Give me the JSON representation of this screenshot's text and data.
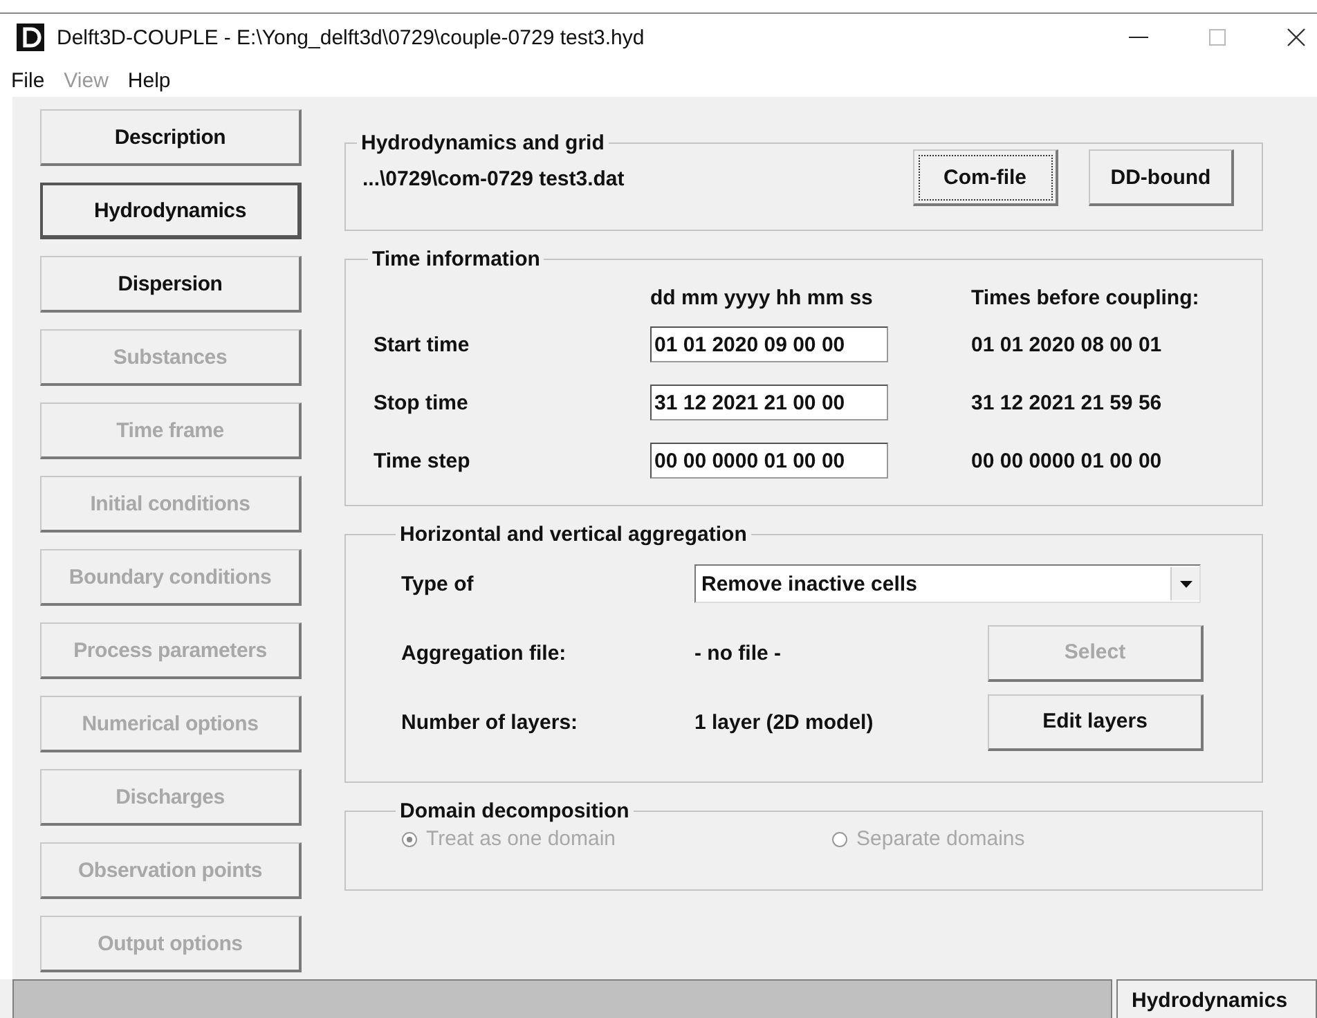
{
  "window": {
    "title": "Delft3D-COUPLE - E:\\Yong_delft3d\\0729\\couple-0729 test3.hyd"
  },
  "menu": [
    {
      "label": "File",
      "disabled": false
    },
    {
      "label": "View",
      "disabled": true
    },
    {
      "label": "Help",
      "disabled": false
    }
  ],
  "nav": [
    {
      "label": "Description",
      "disabled": false,
      "selected": false
    },
    {
      "label": "Hydrodynamics",
      "disabled": false,
      "selected": true
    },
    {
      "label": "Dispersion",
      "disabled": false,
      "selected": false
    },
    {
      "label": "Substances",
      "disabled": true,
      "selected": false
    },
    {
      "label": "Time frame",
      "disabled": true,
      "selected": false
    },
    {
      "label": "Initial conditions",
      "disabled": true,
      "selected": false
    },
    {
      "label": "Boundary conditions",
      "disabled": true,
      "selected": false
    },
    {
      "label": "Process parameters",
      "disabled": true,
      "selected": false
    },
    {
      "label": "Numerical options",
      "disabled": true,
      "selected": false
    },
    {
      "label": "Discharges",
      "disabled": true,
      "selected": false
    },
    {
      "label": "Observation points",
      "disabled": true,
      "selected": false
    },
    {
      "label": "Output options",
      "disabled": true,
      "selected": false
    }
  ],
  "hydro": {
    "title": "Hydrodynamics and grid",
    "file": "...\\0729\\com-0729 test3.dat",
    "buttons": [
      {
        "label": "Com-file",
        "focused": true
      },
      {
        "label": "DD-bound",
        "focused": false
      }
    ]
  },
  "time": {
    "title": "Time information",
    "format": "dd mm yyyy hh mm ss",
    "before_heading": "Times before coupling:",
    "rows": [
      {
        "label": "Start time",
        "value": "01 01 2020 09 00 00",
        "before": "01 01 2020 08 00 01"
      },
      {
        "label": "Stop time",
        "value": "31 12 2021 21 00 00",
        "before": "31 12 2021 21 59 56"
      },
      {
        "label": "Time step",
        "value": "00 00 0000 01 00 00",
        "before": "00 00 0000 01 00 00"
      }
    ]
  },
  "aggregation": {
    "title": "Horizontal and vertical aggregation",
    "type_label": "Type of",
    "type_value": "Remove inactive cells",
    "file_label": "Aggregation file:",
    "file_value": "- no file -",
    "select_button": {
      "label": "Select",
      "disabled": true
    },
    "layers_label": "Number of layers:",
    "layers_value": "1 layer (2D model)",
    "layers_button": {
      "label": "Edit layers",
      "disabled": false
    }
  },
  "domain": {
    "title": "Domain decomposition",
    "disabled": true,
    "options": [
      {
        "label": "Treat as one domain",
        "selected": true
      },
      {
        "label": "Separate domains",
        "selected": false
      }
    ]
  },
  "status_bar": {
    "section": "Hydrodynamics"
  }
}
